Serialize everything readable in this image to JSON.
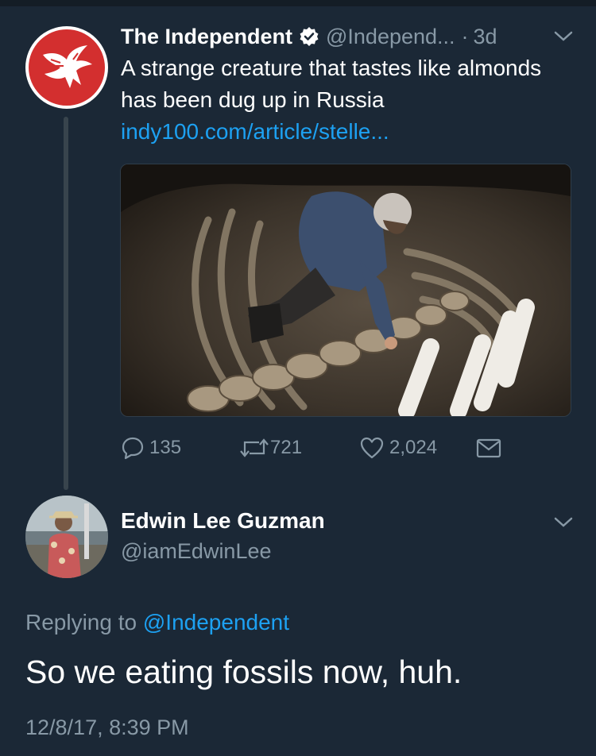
{
  "parent_tweet": {
    "author_name": "The Independent",
    "handle": "@Independ...",
    "separator": "·",
    "time": "3d",
    "text": "A strange creature that tastes like almonds has been dug up in Russia",
    "link": "indy100.com/article/stelle...",
    "counts": {
      "replies": "135",
      "retweets": "721",
      "likes": "2,024"
    },
    "icons": {
      "avatar": "eagle-logo",
      "verified": "verified-badge-icon",
      "menu": "chevron-down-icon",
      "reply": "reply-icon",
      "retweet": "retweet-icon",
      "like": "heart-icon",
      "message": "envelope-icon"
    },
    "media_description_colors": {
      "soil": "#3a342c",
      "bone": "#d8d2c4"
    }
  },
  "reply_tweet": {
    "author_name": "Edwin Lee Guzman",
    "handle": "@iamEdwinLee",
    "replying_prefix": "Replying to",
    "replying_to": "@Independent",
    "text": "So we eating fossils now, huh.",
    "timestamp": "12/8/17, 8:39 PM"
  },
  "colors": {
    "background": "#1b2836",
    "text": "#ffffff",
    "secondary": "#8899a6",
    "link": "#1da1f2",
    "brand_red": "#d32f2f"
  }
}
